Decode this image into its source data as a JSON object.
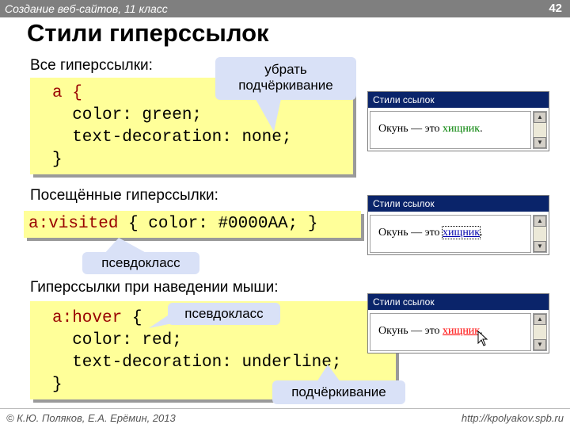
{
  "header": {
    "title": "Создание веб-сайтов, 11 класс",
    "page": "42"
  },
  "slide_title": "Стили гиперссылок",
  "sections": {
    "all": {
      "heading": "Все гиперссылки",
      "colon": ":",
      "code": [
        "a {",
        "  color: green;",
        "  text-decoration: none;",
        "}"
      ],
      "callout_line1": "убрать",
      "callout_line2": "подчёркивание"
    },
    "visited": {
      "heading": "Посещённые гиперссылки",
      "colon": ":",
      "code_sel": "a:visited",
      "code_rest": " { color: #0000AA; }",
      "callout": "псевдокласс"
    },
    "hover": {
      "heading": "Гиперссылки при наведении мыши",
      "colon": ":",
      "code_sel": "a:hover",
      "code_rest": " {",
      "code_lines": [
        "  color: red;",
        "  text-decoration: underline;",
        "}"
      ],
      "callout_pseudo": "псевдокласс",
      "callout_underline": "подчёркивание"
    }
  },
  "browser": {
    "title": "Стили ссылок",
    "text_before": "Окунь — это ",
    "link": "хищник",
    "text_after": "."
  },
  "colors": {
    "green": "#008000",
    "visited": "#0000AA",
    "hover": "#ff0000"
  },
  "footer": {
    "left": "© К.Ю. Поляков, Е.А. Ерёмин, 2013",
    "right": "http://kpolyakov.spb.ru"
  }
}
